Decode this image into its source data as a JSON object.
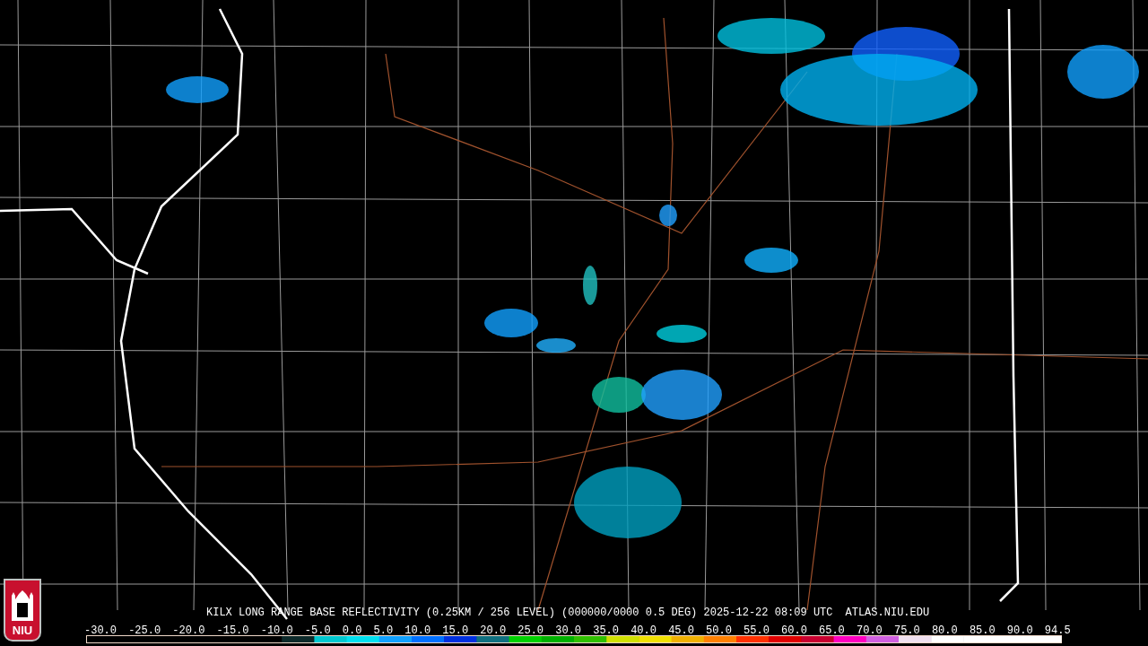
{
  "logo": {
    "text": "NIU"
  },
  "caption": {
    "product": "KILX LONG RANGE BASE REFLECTIVITY (0.25KM / 256 LEVEL) (000000/0000 0.5 DEG) 2025-12-22 08:09 UTC",
    "source": "ATLAS.NIU.EDU"
  },
  "scale": {
    "ticks": [
      "-30.0",
      "-25.0",
      "-20.0",
      "-15.0",
      "-10.0",
      "-5.0",
      "0.0",
      "5.0",
      "10.0",
      "15.0",
      "20.0",
      "25.0",
      "30.0",
      "35.0",
      "40.0",
      "45.0",
      "50.0",
      "55.0",
      "60.0",
      "65.0",
      "70.0",
      "75.0",
      "80.0",
      "85.0",
      "90.0",
      "94.5"
    ]
  }
}
